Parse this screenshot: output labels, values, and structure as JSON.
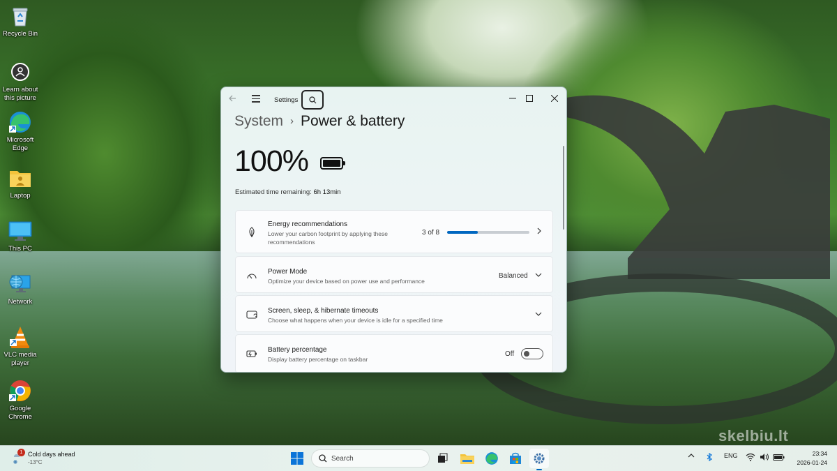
{
  "desktop": {
    "icons": [
      {
        "label": "Recycle Bin",
        "icon": "recycle-bin-icon"
      },
      {
        "label": "Learn about\nthis picture",
        "icon": "camera-icon"
      },
      {
        "label": "Microsoft\nEdge",
        "icon": "edge-icon"
      },
      {
        "label": "Laptop",
        "icon": "user-folder-icon"
      },
      {
        "label": "This PC",
        "icon": "monitor-icon"
      },
      {
        "label": "Network",
        "icon": "network-icon"
      },
      {
        "label": "VLC media\nplayer",
        "icon": "vlc-icon"
      },
      {
        "label": "Google\nChrome",
        "icon": "chrome-icon"
      }
    ],
    "watermark": "skelbiu.lt"
  },
  "window": {
    "app_title": "Settings",
    "breadcrumb_root": "System",
    "breadcrumb_separator": "›",
    "page_title": "Power & battery",
    "battery_percent": "100%",
    "battery_level": 1.0,
    "estimate_label": "Estimated time remaining:",
    "estimate_value": "6h 13min",
    "cards": {
      "energy": {
        "title": "Energy recommendations",
        "subtitle": "Lower your carbon footprint by applying these recommendations",
        "progress_text": "3 of 8",
        "progress_value": 0.375
      },
      "power_mode": {
        "title": "Power Mode",
        "subtitle": "Optimize your device based on power use and performance",
        "value": "Balanced"
      },
      "sleep": {
        "title": "Screen, sleep, & hibernate timeouts",
        "subtitle": "Choose what happens when your device is idle for a specified time"
      },
      "battery_pct": {
        "title": "Battery percentage",
        "subtitle": "Display battery percentage on taskbar",
        "state": "Off"
      }
    }
  },
  "taskbar": {
    "weather_title": "Cold days ahead",
    "weather_temp": "-13°C",
    "weather_badge": "1",
    "search_placeholder": "Search",
    "language": "ENG",
    "time": "23:34",
    "date": "2026-01-24",
    "accent": "#0067c0"
  }
}
